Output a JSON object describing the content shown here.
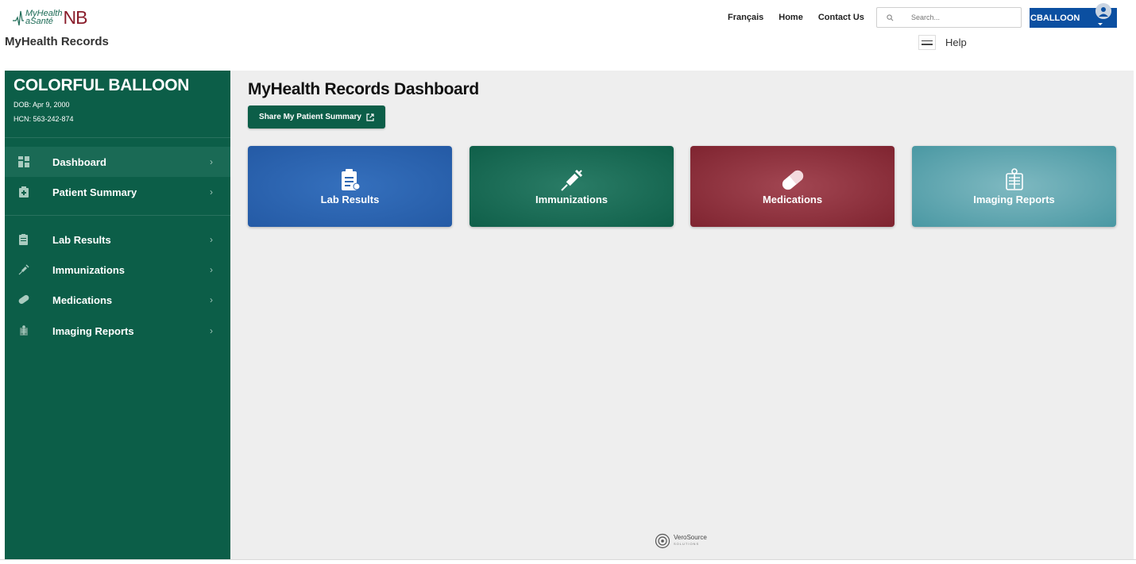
{
  "header": {
    "logo_top": "MyHealth",
    "logo_bottom": "aSanté",
    "logo_nb": "NB",
    "app_title": "MyHealth Records",
    "nav": [
      "Français",
      "Home",
      "Contact Us"
    ],
    "search_placeholder": "Search...",
    "user_label": "CBALLOON",
    "help_label": "Help"
  },
  "patient": {
    "name": "COLORFUL BALLOON",
    "dob": "DOB: Apr 9, 2000",
    "hcn": "HCN: 563-242-874"
  },
  "sidebar": {
    "items": [
      {
        "label": "Dashboard",
        "icon": "dashboard-icon",
        "active": true
      },
      {
        "label": "Patient Summary",
        "icon": "patient-summary-icon"
      },
      {
        "label": "Lab Results",
        "icon": "clipboard-icon"
      },
      {
        "label": "Immunizations",
        "icon": "syringe-icon"
      },
      {
        "label": "Medications",
        "icon": "pill-icon"
      },
      {
        "label": "Imaging Reports",
        "icon": "xray-icon"
      }
    ]
  },
  "main": {
    "title": "MyHealth Records Dashboard",
    "share_button": "Share My Patient Summary",
    "tiles": [
      {
        "label": "Lab Results",
        "color": "#245aa5",
        "icon": "clipboard-icon"
      },
      {
        "label": "Immunizations",
        "color": "#0f5f49",
        "icon": "syringe-icon"
      },
      {
        "label": "Medications",
        "color": "#7f2430",
        "icon": "pill-icon"
      },
      {
        "label": "Imaging Reports",
        "color": "#4a98a3",
        "icon": "xray-icon"
      }
    ]
  },
  "footer": {
    "brand": "VeroSource",
    "brand_sub": "SOLUTIONS"
  },
  "colors": {
    "sidebar": "#0c5e48",
    "primary_blue": "#0b4fa1",
    "main_bg": "#eeeeee"
  }
}
